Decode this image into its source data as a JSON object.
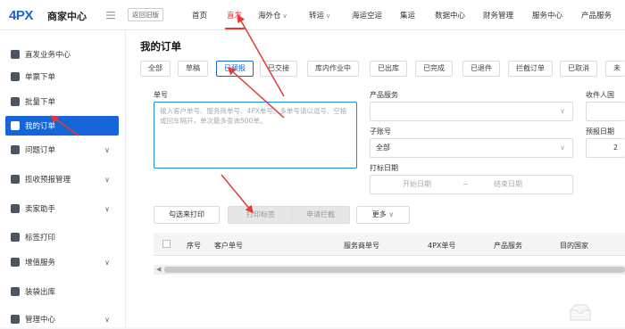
{
  "header": {
    "logo": "4PX",
    "brand": "商家中心",
    "old_version": "返回旧版",
    "nav": [
      {
        "label": "首页"
      },
      {
        "label": "直发"
      },
      {
        "label": "海外仓"
      },
      {
        "label": "转运"
      },
      {
        "label": "海运空运"
      },
      {
        "label": "集运"
      },
      {
        "label": "数据中心"
      },
      {
        "label": "财务管理"
      },
      {
        "label": "服务中心"
      },
      {
        "label": "产品服务"
      }
    ]
  },
  "sidebar": {
    "items": [
      {
        "label": "直发业务中心",
        "icon": "home-icon"
      },
      {
        "label": "单票下单",
        "icon": "single-order-icon"
      },
      {
        "label": "批量下单",
        "icon": "batch-order-icon"
      },
      {
        "label": "我的订单",
        "icon": "order-icon"
      },
      {
        "label": "问题订单",
        "icon": "issue-icon"
      },
      {
        "label": "揽收预报管理",
        "icon": "pickup-icon"
      },
      {
        "label": "卖家助手",
        "icon": "seller-icon"
      },
      {
        "label": "标签打印",
        "icon": "print-icon"
      },
      {
        "label": "增值服务",
        "icon": "value-added-icon"
      },
      {
        "label": "装袋出库",
        "icon": "bag-icon"
      },
      {
        "label": "管理中心",
        "icon": "admin-icon"
      }
    ]
  },
  "main": {
    "title": "我的订单",
    "tabs": [
      "全部",
      "草稿",
      "已预报",
      "已交接",
      "库内作业中",
      "已出库",
      "已完成",
      "已退件",
      "拦截订单",
      "已取消",
      "未"
    ],
    "filters": {
      "order_no_label": "单号",
      "order_no_placeholder": "输入客户单号、服务商单号、4PX单号。多单号请以逗号、空格或回车隔开，单次最多查询500单。",
      "product_label": "产品服务",
      "recipient_label": "收件人国",
      "sub_account_label": "子账号",
      "sub_account_value": "全部",
      "forecast_date_label": "预报日期",
      "forecast_date_value": "2",
      "label_date_label": "打标日期",
      "start_date": "开始日期",
      "range_sep": "~",
      "end_date": "结束日期"
    },
    "actions": {
      "print_selected": "勾选来打印",
      "print_label": "打印标签",
      "apply_intercept": "申请拦截",
      "more": "更多"
    },
    "table": {
      "columns": [
        "序号",
        "客户单号",
        "服务商单号",
        "4PX单号",
        "产品服务",
        "目的国家"
      ]
    }
  }
}
